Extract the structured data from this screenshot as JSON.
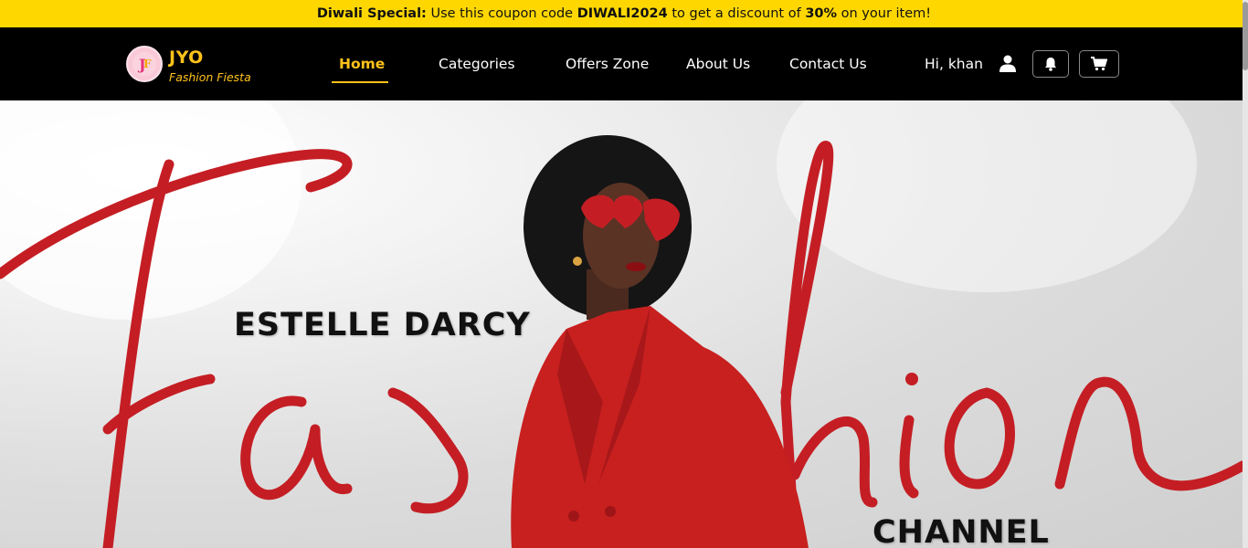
{
  "promo": {
    "label": "Diwali Special:",
    "text_1": " Use this coupon code ",
    "code": "DIWALI2024",
    "text_2": " to get a discount of ",
    "discount": "30%",
    "text_3": " on your item!"
  },
  "brand": {
    "name": "JYO",
    "tagline": "Fashion Fiesta"
  },
  "nav": {
    "home": "Home",
    "categories": "Categories",
    "offers": "Offers Zone",
    "about": "About Us",
    "contact": "Contact Us"
  },
  "user": {
    "greeting": "Hi, khan"
  },
  "hero": {
    "headline": "ESTELLE DARCY",
    "script_text": "Fashion",
    "footer": "CHANNEL"
  },
  "colors": {
    "promo_bg": "#ffd700",
    "navbar_bg": "#000000",
    "accent": "#ffc21a",
    "hero_red": "#c41e24"
  },
  "icons": [
    "user-icon",
    "bell-icon",
    "cart-icon"
  ]
}
